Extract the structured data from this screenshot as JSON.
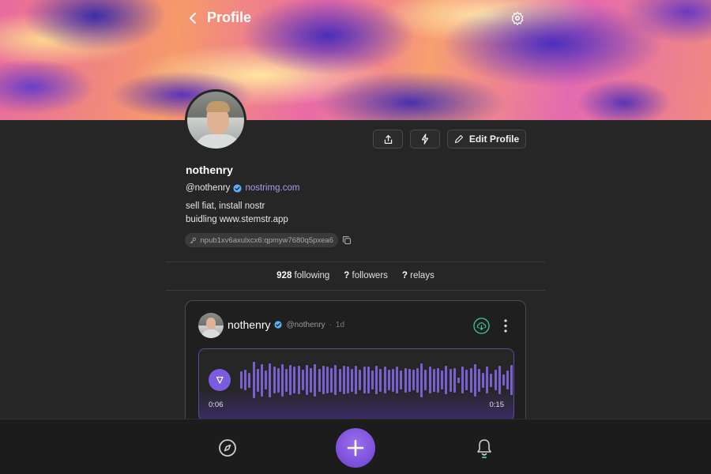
{
  "header": {
    "title": "Profile",
    "back_icon": "chevron-left-icon",
    "settings_icon": "gear-icon"
  },
  "profile": {
    "display_name": "nothenry",
    "handle": "@nothenry",
    "nip05": "nostrimg.com",
    "bio_line1": "sell fiat, install nostr",
    "bio_line2": "buidling www.stemstr.app",
    "npub": "npub1xv6axulxcx6:qpmyw7680q5pxea6"
  },
  "actions": {
    "share_icon": "share-icon",
    "zap_icon": "lightning-icon",
    "edit_label": "Edit Profile"
  },
  "stats": {
    "following_count": "928",
    "following_label": "following",
    "followers_count": "?",
    "followers_label": "followers",
    "relays_count": "?",
    "relays_label": "relays"
  },
  "post": {
    "author_name": "nothenry",
    "author_handle": "@nothenry",
    "time_sep": "·",
    "time": "1d",
    "current_time": "0:06",
    "total_time": "0:15",
    "waveform_levels": [
      0.45,
      0.55,
      0.4,
      0.95,
      0.6,
      0.85,
      0.5,
      0.9,
      0.7,
      0.65,
      0.85,
      0.6,
      0.8,
      0.7,
      0.75,
      0.55,
      0.8,
      0.65,
      0.85,
      0.6,
      0.75,
      0.7,
      0.65,
      0.8,
      0.6,
      0.75,
      0.7,
      0.6,
      0.75,
      0.55,
      0.7,
      0.7,
      0.5,
      0.75,
      0.6,
      0.7,
      0.55,
      0.6,
      0.7,
      0.5,
      0.65,
      0.6,
      0.55,
      0.65,
      0.9,
      0.55,
      0.7,
      0.6,
      0.65,
      0.5,
      0.75,
      0.6,
      0.65,
      0.15,
      0.7,
      0.55,
      0.65,
      0.85,
      0.6,
      0.4,
      0.7,
      0.35,
      0.55,
      0.75,
      0.3,
      0.5,
      0.8,
      0.45,
      0.85
    ]
  },
  "nav": {
    "explore_icon": "compass-icon",
    "add_icon": "plus-icon",
    "notifications_icon": "bell-icon"
  },
  "colors": {
    "accent": "#7b5ce0",
    "verified": "#5ab0ff",
    "nip05_link": "#a99af0",
    "download_ring": "#3dbf9a"
  }
}
